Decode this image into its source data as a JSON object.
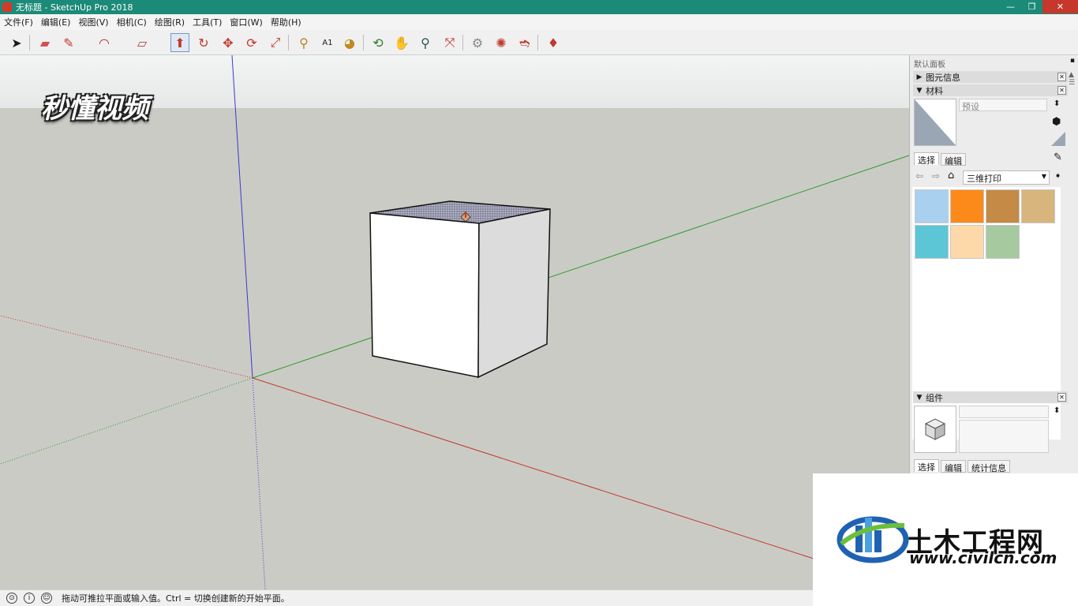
{
  "window": {
    "title": "无标题 - SketchUp Pro 2018"
  },
  "menu": [
    "文件(F)",
    "编辑(E)",
    "视图(V)",
    "相机(C)",
    "绘图(R)",
    "工具(T)",
    "窗口(W)",
    "帮助(H)"
  ],
  "watermark_logo": "秒懂视频",
  "tray": {
    "title": "默认面板",
    "entity_info": "图元信息",
    "materials": {
      "header": "材料",
      "name_placeholder": "预设",
      "tabs": [
        "选择",
        "编辑"
      ],
      "library": "三维打印",
      "swatch_colors": [
        "#a9d1ef",
        "#fb8a1a",
        "#c48a46",
        "#d7b57d",
        "#5cc6d6",
        "#fdd8a8",
        "#a7c9a0"
      ]
    },
    "components": {
      "header": "组件",
      "tabs": [
        "选择",
        "编辑",
        "统计信息"
      ]
    }
  },
  "status": {
    "text": "拖动可推拉平面或输入值。Ctrl = 切换创建新的开始平面。"
  },
  "site_watermark": {
    "name": "土木工程网",
    "url": "www.civilcn.com"
  },
  "colors": {
    "titlebar": "#1c8a78",
    "x_axis": "#c0392b",
    "y_axis": "#2e9b2e",
    "z_axis": "#3a3ac8"
  }
}
